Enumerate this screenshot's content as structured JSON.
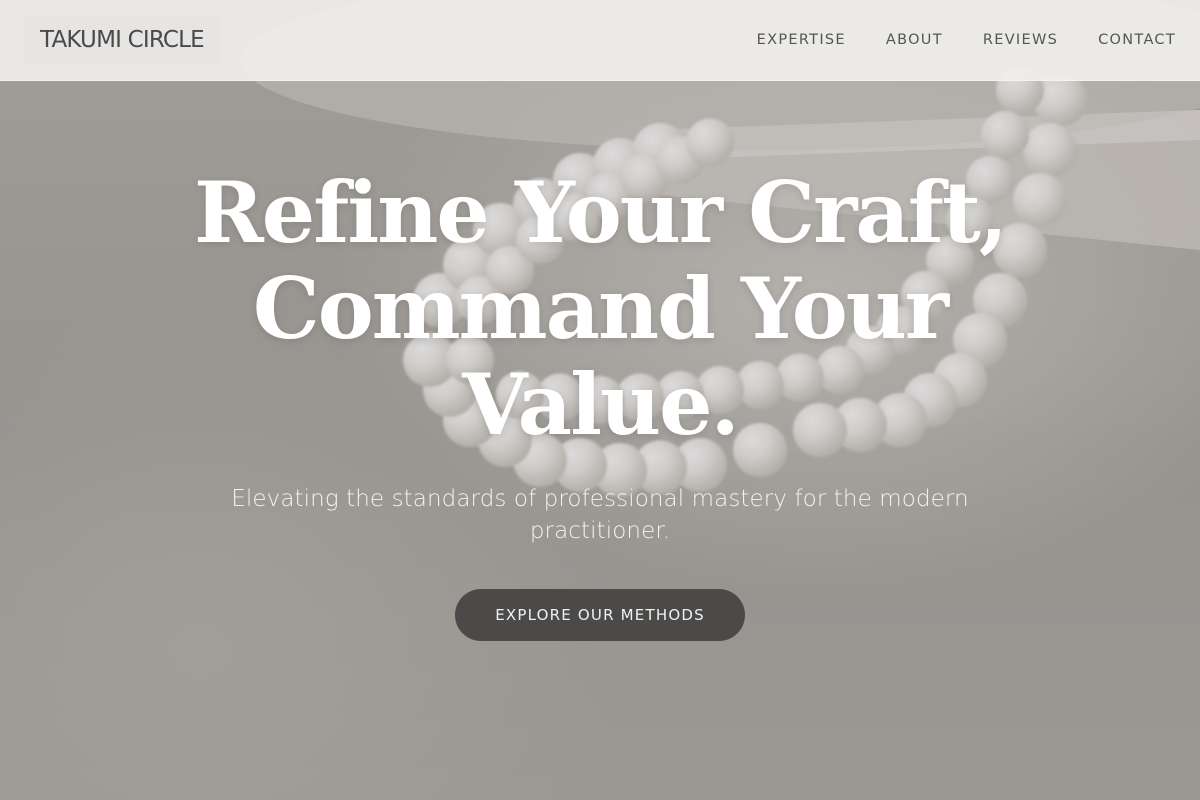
{
  "nav": {
    "logo": "TAKUMI CIRCLE",
    "links": [
      "EXPERTISE",
      "ABOUT",
      "REVIEWS",
      "CONTACT"
    ]
  },
  "hero": {
    "headline_lines": [
      "Refine Your Craft,",
      "Command Your",
      "Value."
    ],
    "subtitle_lines": [
      "Elevating the standards of professional mastery for the modern",
      "practitioner."
    ],
    "cta_label": "EXPLORE OUR METHODS",
    "background_image": "pearl-necklace-photo"
  },
  "colors": {
    "nav_background": "#f0efed",
    "headline_text": "#ffffff",
    "cta_background": "#4b4a49"
  }
}
